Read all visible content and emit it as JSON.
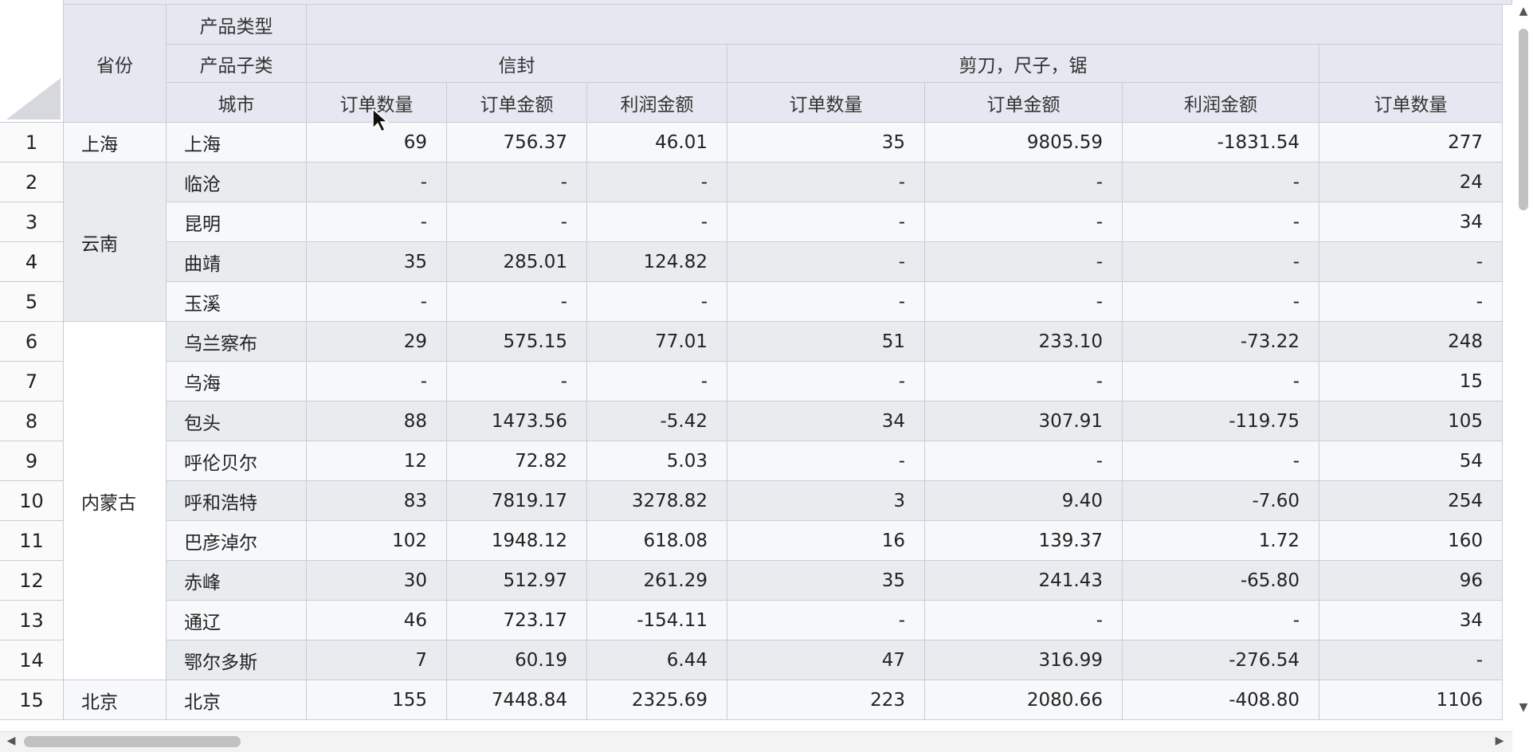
{
  "header": {
    "row_field_label": "省份",
    "product_type_label": "产品类型",
    "product_subtype_label": "产品子类",
    "city_label": "城市",
    "subtype_groups": [
      {
        "name": "信封",
        "span": 3
      },
      {
        "name": "剪刀，尺子，锯",
        "span": 3
      },
      {
        "name": "",
        "span": 1
      }
    ],
    "measures": [
      "订单数量",
      "订单金额",
      "利润金额",
      "订单数量",
      "订单金额",
      "利润金额",
      "订单数量"
    ]
  },
  "provinces": [
    {
      "name": "上海",
      "start": 0,
      "span": 1
    },
    {
      "name": "云南",
      "start": 1,
      "span": 4
    },
    {
      "name": "内蒙古",
      "start": 5,
      "span": 9
    },
    {
      "name": "北京",
      "start": 14,
      "span": 1
    }
  ],
  "rows": [
    {
      "num": "1",
      "city": "上海",
      "values": [
        "69",
        "756.37",
        "46.01",
        "35",
        "9805.59",
        "-1831.54",
        "277"
      ]
    },
    {
      "num": "2",
      "city": "临沧",
      "values": [
        "-",
        "-",
        "-",
        "-",
        "-",
        "-",
        "24"
      ]
    },
    {
      "num": "3",
      "city": "昆明",
      "values": [
        "-",
        "-",
        "-",
        "-",
        "-",
        "-",
        "34"
      ]
    },
    {
      "num": "4",
      "city": "曲靖",
      "values": [
        "35",
        "285.01",
        "124.82",
        "-",
        "-",
        "-",
        "-"
      ]
    },
    {
      "num": "5",
      "city": "玉溪",
      "values": [
        "-",
        "-",
        "-",
        "-",
        "-",
        "-",
        "-"
      ]
    },
    {
      "num": "6",
      "city": "乌兰察布",
      "values": [
        "29",
        "575.15",
        "77.01",
        "51",
        "233.10",
        "-73.22",
        "248"
      ]
    },
    {
      "num": "7",
      "city": "乌海",
      "values": [
        "-",
        "-",
        "-",
        "-",
        "-",
        "-",
        "15"
      ]
    },
    {
      "num": "8",
      "city": "包头",
      "values": [
        "88",
        "1473.56",
        "-5.42",
        "34",
        "307.91",
        "-119.75",
        "105"
      ]
    },
    {
      "num": "9",
      "city": "呼伦贝尔",
      "values": [
        "12",
        "72.82",
        "5.03",
        "-",
        "-",
        "-",
        "54"
      ]
    },
    {
      "num": "10",
      "city": "呼和浩特",
      "values": [
        "83",
        "7819.17",
        "3278.82",
        "3",
        "9.40",
        "-7.60",
        "254"
      ]
    },
    {
      "num": "11",
      "city": "巴彦淖尔",
      "values": [
        "102",
        "1948.12",
        "618.08",
        "16",
        "139.37",
        "1.72",
        "160"
      ]
    },
    {
      "num": "12",
      "city": "赤峰",
      "values": [
        "30",
        "512.97",
        "261.29",
        "35",
        "241.43",
        "-65.80",
        "96"
      ]
    },
    {
      "num": "13",
      "city": "通辽",
      "values": [
        "46",
        "723.17",
        "-154.11",
        "-",
        "-",
        "-",
        "34"
      ]
    },
    {
      "num": "14",
      "city": "鄂尔多斯",
      "values": [
        "7",
        "60.19",
        "6.44",
        "47",
        "316.99",
        "-276.54",
        "-"
      ]
    },
    {
      "num": "15",
      "city": "北京",
      "values": [
        "155",
        "7448.84",
        "2325.69",
        "223",
        "2080.66",
        "-408.80",
        "1106"
      ]
    }
  ],
  "colors": {
    "header_bg": "#e6e8f1",
    "row_light": "#f7f8fa",
    "row_dark": "#e9ecef",
    "border": "#c9ccd6"
  }
}
